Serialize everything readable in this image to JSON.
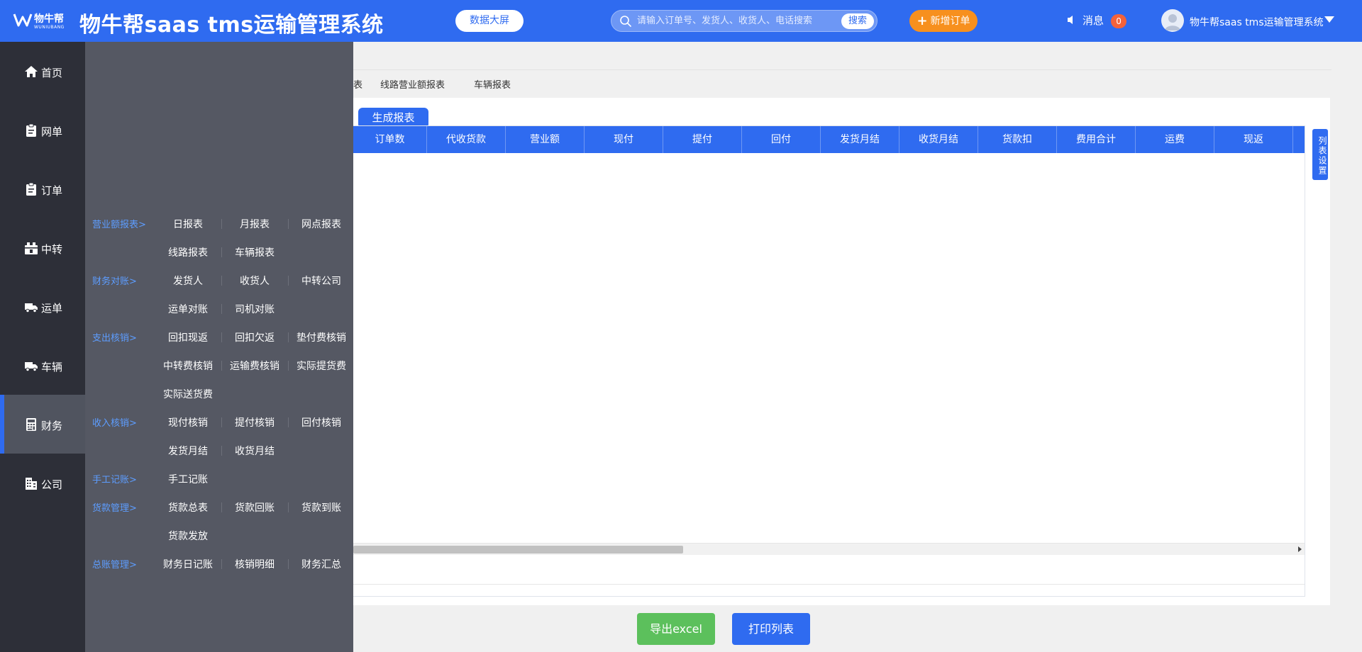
{
  "header": {
    "logo_cn": "物牛帮",
    "logo_en": "WUNIUBANG",
    "title": "物牛帮saas tms运输管理系统",
    "data_screen_label": "数据大屏",
    "search_placeholder": "请输入订单号、发货人、收货人、电话搜索",
    "search_button": "搜索",
    "new_order_label": "新增订单",
    "messages_label": "消息",
    "messages_count": "0",
    "user_name": "物牛帮saas tms运输管理系统"
  },
  "nav": {
    "items": [
      {
        "label": "首页",
        "icon": "home-icon"
      },
      {
        "label": "网单",
        "icon": "clipboard-icon"
      },
      {
        "label": "订单",
        "icon": "clipboard-icon"
      },
      {
        "label": "中转",
        "icon": "transfer-icon"
      },
      {
        "label": "运单",
        "icon": "truck-icon"
      },
      {
        "label": "车辆",
        "icon": "truck-icon"
      },
      {
        "label": "财务",
        "icon": "calculator-icon"
      },
      {
        "label": "公司",
        "icon": "building-icon"
      }
    ],
    "active": "财务"
  },
  "flyout": {
    "groups": [
      {
        "category": "营业额报表>",
        "rows": [
          [
            "日报表",
            "月报表",
            "网点报表"
          ],
          [
            "线路报表",
            "车辆报表"
          ]
        ]
      },
      {
        "category": "财务对账>",
        "rows": [
          [
            "发货人",
            "收货人",
            "中转公司"
          ],
          [
            "运单对账",
            "司机对账"
          ]
        ]
      },
      {
        "category": "支出核销>",
        "rows": [
          [
            "回扣现返",
            "回扣欠返",
            "垫付费核销"
          ],
          [
            "中转费核销",
            "运输费核销",
            "实际提货费"
          ],
          [
            "实际送货费"
          ]
        ]
      },
      {
        "category": "收入核销>",
        "rows": [
          [
            "现付核销",
            "提付核销",
            "回付核销"
          ],
          [
            "发货月结",
            "收货月结"
          ]
        ]
      },
      {
        "category": "手工记账>",
        "rows": [
          [
            "手工记账"
          ]
        ]
      },
      {
        "category": "货款管理>",
        "rows": [
          [
            "货款总表",
            "货款回账",
            "货款到账"
          ],
          [
            "货款发放"
          ]
        ]
      },
      {
        "category": "总账管理>",
        "rows": [
          [
            "财务日记账",
            "核销明细",
            "财务汇总"
          ]
        ]
      }
    ]
  },
  "main": {
    "tabs": [
      "表",
      "线路营业额报表",
      "车辆报表"
    ],
    "generate_button": "生成报表",
    "columns": [
      "订单数",
      "代收货款",
      "营业额",
      "现付",
      "提付",
      "回付",
      "发货月结",
      "收货月结",
      "货款扣",
      "费用合计",
      "运费",
      "现返"
    ],
    "column_settings": "列表设置",
    "export_button": "导出excel",
    "print_button": "打印列表"
  },
  "colors": {
    "primary": "#2f6bf0",
    "orange": "#f7901e",
    "green": "#5cc05c",
    "nav_bg": "#2d2f38",
    "flyout_bg": "#555863",
    "category_text": "#5d9dff"
  }
}
